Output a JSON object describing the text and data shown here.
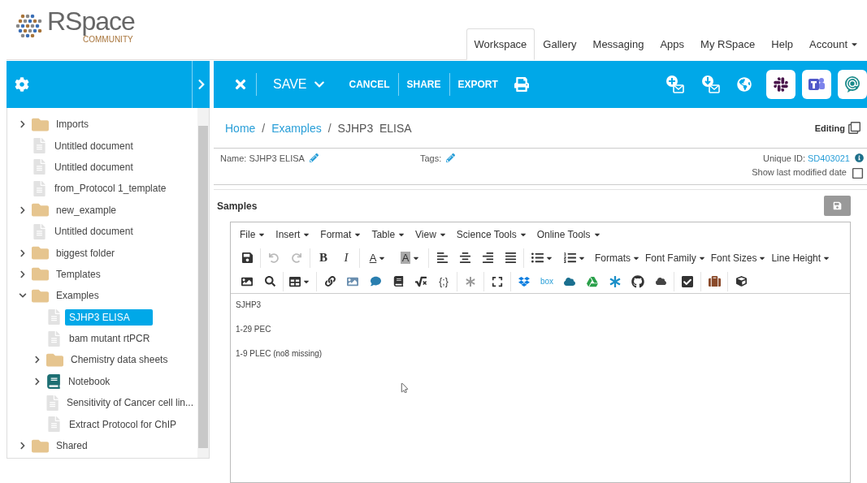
{
  "logo": {
    "name": "RSpace",
    "subtitle": "COMMUNITY"
  },
  "nav": [
    {
      "label": "Workspace",
      "selected": true
    },
    {
      "label": "Gallery",
      "selected": false
    },
    {
      "label": "Messaging",
      "selected": false
    },
    {
      "label": "Apps",
      "selected": false
    },
    {
      "label": "My RSpace",
      "selected": false
    },
    {
      "label": "Help",
      "selected": false
    },
    {
      "label": "Account",
      "selected": false,
      "has_menu": true
    }
  ],
  "toolbar": {
    "save": "SAVE",
    "actions": [
      "CANCEL",
      "SHARE",
      "EXPORT"
    ]
  },
  "tree": [
    {
      "label": "Imports",
      "kind": "folder",
      "expanded": false,
      "selected": false
    },
    {
      "label": "Untitled document",
      "kind": "document",
      "selected": false
    },
    {
      "label": "Untitled document",
      "kind": "document",
      "selected": false
    },
    {
      "label": "from_Protocol 1_template",
      "kind": "document",
      "selected": false
    },
    {
      "label": "new_example",
      "kind": "folder",
      "expanded": false,
      "selected": false
    },
    {
      "label": "Untitled document",
      "kind": "document",
      "selected": false
    },
    {
      "label": "biggest folder",
      "kind": "folder",
      "expanded": false,
      "selected": false
    },
    {
      "label": "Templates",
      "kind": "folder",
      "expanded": false,
      "selected": false
    },
    {
      "label": "Examples",
      "kind": "folder",
      "expanded": true,
      "selected": false,
      "children": [
        {
          "label": "SJHP3 ELISA",
          "kind": "document",
          "selected": true
        },
        {
          "label": "bam mutant rtPCR",
          "kind": "document",
          "selected": false
        },
        {
          "label": "Chemistry data sheets",
          "kind": "folder",
          "expanded": false,
          "selected": false
        },
        {
          "label": "Notebook",
          "kind": "notebook",
          "expanded": false,
          "selected": false
        },
        {
          "label": "Sensitivity of Cancer cell lin...",
          "kind": "document",
          "selected": false
        },
        {
          "label": "Extract Protocol for ChIP",
          "kind": "document",
          "selected": false
        }
      ]
    },
    {
      "label": "Shared",
      "kind": "folder",
      "expanded": false,
      "selected": false
    }
  ],
  "breadcrumb": {
    "links": [
      "Home",
      "Examples"
    ],
    "separator": "/",
    "current": "SJHP3  ELISA",
    "mode": "Editing"
  },
  "details": {
    "name": "Name: SJHP3 ELISA",
    "tags": "Tags:",
    "id_label": "Unique ID:",
    "id": "SD403021",
    "modified": {
      "label": "Show last modified date",
      "checked": false
    }
  },
  "section": "Samples",
  "editor": {
    "menus": [
      "File",
      "Insert",
      "Format",
      "Table",
      "View",
      "Science Tools",
      "Online Tools"
    ],
    "bold": "B",
    "italic": "I",
    "text_color": "A",
    "highlight": "A",
    "dropdowns": [
      "Formats",
      "Font Family",
      "Font Sizes",
      "Line Height"
    ],
    "code": "{;}",
    "box": "box",
    "content": [
      "SJHP3",
      "1-29 PEC",
      "1-9 PLEC (no8 missing)"
    ]
  }
}
